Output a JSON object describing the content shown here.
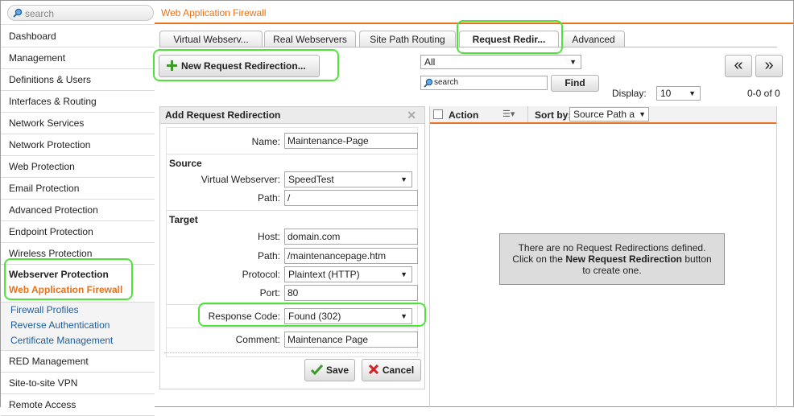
{
  "search": {
    "placeholder": "search"
  },
  "sidebar": {
    "items_top": [
      "Dashboard",
      "Management",
      "Definitions & Users",
      "Interfaces & Routing",
      "Network Services",
      "Network Protection",
      "Web Protection",
      "Email Protection",
      "Advanced Protection",
      "Endpoint Protection",
      "Wireless Protection"
    ],
    "group_title": "Webserver Protection",
    "group_active": "Web Application Firewall",
    "subitems": [
      "Firewall Profiles",
      "Reverse Authentication",
      "Certificate Management"
    ],
    "items_bottom": [
      "RED Management",
      "Site-to-site VPN",
      "Remote Access"
    ]
  },
  "header": {
    "title": "Web Application Firewall"
  },
  "tabs": [
    "Virtual Webserv...",
    "Real Webservers",
    "Site Path Routing",
    "Request Redir...",
    "Advanced"
  ],
  "toolbar": {
    "new_button": "New Request Redirection...",
    "filter_value": "All",
    "search_placeholder": "search",
    "find_label": "Find",
    "display_label": "Display:",
    "display_value": "10",
    "range": "0-0 of 0",
    "prev_label": "«",
    "next_label": "»"
  },
  "form": {
    "title": "Add Request Redirection",
    "name_label": "Name:",
    "name_value": "Maintenance-Page",
    "source_title": "Source",
    "vws_label": "Virtual Webserver:",
    "vws_value": "SpeedTest",
    "spath_label": "Path:",
    "spath_value": "/",
    "target_title": "Target",
    "host_label": "Host:",
    "host_value": "domain.com",
    "tpath_label": "Path:",
    "tpath_value": "/maintenancepage.htm",
    "proto_label": "Protocol:",
    "proto_value": "Plaintext (HTTP)",
    "port_label": "Port:",
    "port_value": "80",
    "code_label": "Response Code:",
    "code_value": "Found (302)",
    "comment_label": "Comment:",
    "comment_value": "Maintenance Page",
    "save_label": "Save",
    "cancel_label": "Cancel"
  },
  "list": {
    "action_label": "Action",
    "sortby_label": "Sort by:",
    "sortby_value": "Source Path a",
    "empty_line1": "There are no Request Redirections defined.",
    "empty_line2_pre": "Click on the ",
    "empty_line2_bold": "New Request Redirection",
    "empty_line2_post": " button",
    "empty_line3": "to create one."
  },
  "colors": {
    "accent": "#e8731c",
    "link": "#1d5fa0",
    "highlight": "#4ee23a"
  }
}
